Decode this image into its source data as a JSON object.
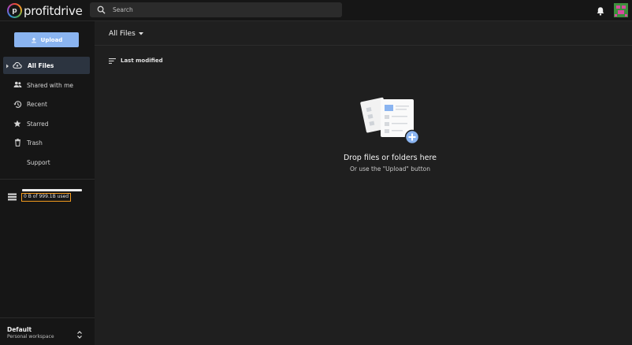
{
  "app": {
    "logo_mark": "p",
    "logo_text": "profitdrive"
  },
  "header": {
    "search_placeholder": "Search",
    "icons": [
      "search-icon",
      "bell-icon",
      "avatar"
    ]
  },
  "sidebar": {
    "upload_label": "Upload",
    "items": [
      {
        "label": "All Files",
        "icon": "cloud-icon",
        "active": true
      },
      {
        "label": "Shared with me",
        "icon": "people-icon",
        "active": false
      },
      {
        "label": "Recent",
        "icon": "history-icon",
        "active": false
      },
      {
        "label": "Starred",
        "icon": "star-icon",
        "active": false
      },
      {
        "label": "Trash",
        "icon": "trash-icon",
        "active": false
      },
      {
        "label": "Support",
        "icon": "",
        "active": false
      }
    ],
    "storage_text": "0 B  of 999.1B used",
    "storage_fraction": 1.0,
    "workspace_name": "Default",
    "workspace_sub": "Personal workspace"
  },
  "main": {
    "title": "All Files",
    "sort_label": "Last modified",
    "empty_title": "Drop files or folders here",
    "empty_sub": "Or use the \"Upload\" button"
  },
  "colors": {
    "accent": "#8ab4f0",
    "highlight": "#f39a1e",
    "sidebar_bg": "#161616",
    "main_bg": "#1f1f1f"
  }
}
